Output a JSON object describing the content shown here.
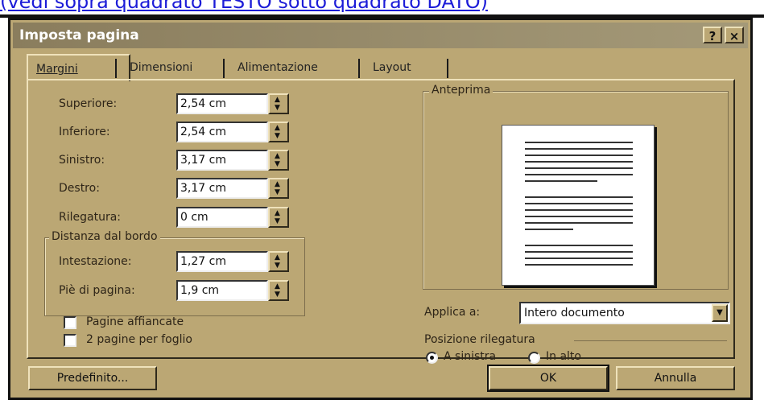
{
  "background_text": "(vedi sopra quadrato TESTO sotto quadrato DATO)",
  "dialog": {
    "title": "Imposta pagina",
    "help_btn": "?",
    "close_btn": "×"
  },
  "tabs": [
    {
      "label": "Margini",
      "active": true
    },
    {
      "label": "Dimensioni",
      "active": false
    },
    {
      "label": "Alimentazione",
      "active": false
    },
    {
      "label": "Layout",
      "active": false
    }
  ],
  "margins": {
    "superiore": {
      "label": "Superiore:",
      "value": "2,54 cm"
    },
    "inferiore": {
      "label": "Inferiore:",
      "value": "2,54 cm"
    },
    "sinistro": {
      "label": "Sinistro:",
      "value": "3,17 cm"
    },
    "destro": {
      "label": "Destro:",
      "value": "3,17 cm"
    },
    "rilegatura": {
      "label": "Rilegatura:",
      "value": "0 cm"
    }
  },
  "distanza": {
    "group_title": "Distanza dal bordo",
    "intestazione": {
      "label": "Intestazione:",
      "value": "1,27 cm"
    },
    "pie": {
      "label": "Piè di pagina:",
      "value": "1,9 cm"
    }
  },
  "checkboxes": {
    "pagine_affiancate": {
      "label": "Pagine affiancate",
      "checked": false
    },
    "due_pagine": {
      "label": "2 pagine per foglio",
      "checked": false
    }
  },
  "anteprima": {
    "title": "Anteprima"
  },
  "applica": {
    "label": "Applica a:",
    "value": "Intero documento"
  },
  "posizione": {
    "title": "Posizione rilegatura",
    "options": [
      {
        "label": "A sinistra",
        "selected": true
      },
      {
        "label": "In alto",
        "selected": false
      }
    ]
  },
  "buttons": {
    "predefinito": "Predefinito...",
    "ok": "OK",
    "annulla": "Annulla"
  },
  "icons": {
    "spin_up": "▲",
    "spin_down": "▼",
    "dropdown": "▼"
  },
  "colors": {
    "dialog_bg": "#bba774",
    "titlebar": "#8a7d5d",
    "link_text": "#1c1cd8"
  }
}
